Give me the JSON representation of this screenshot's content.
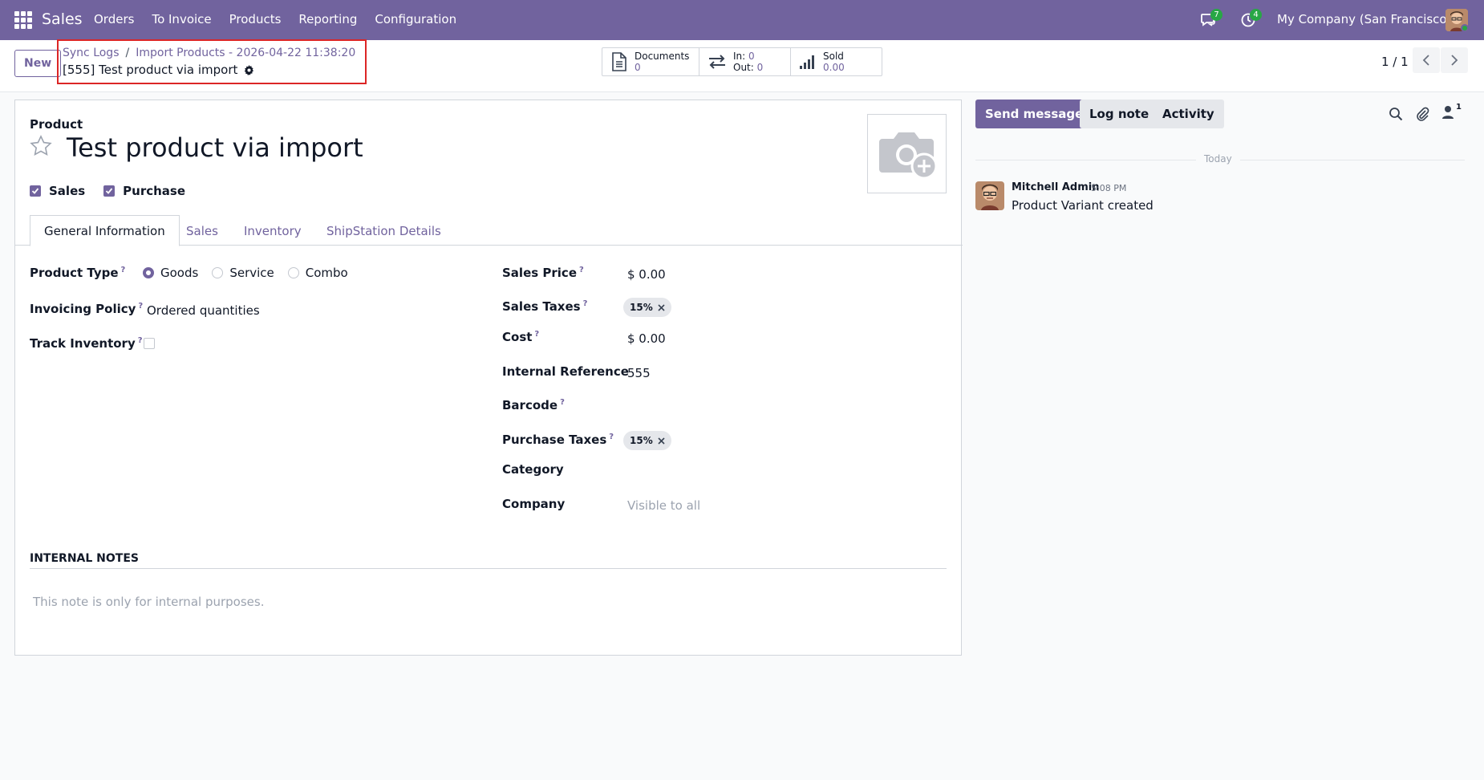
{
  "navbar": {
    "brand": "Sales",
    "menu": [
      "Orders",
      "To Invoice",
      "Products",
      "Reporting",
      "Configuration"
    ],
    "chat_count": "7",
    "activity_count": "4",
    "company": "My Company (San Francisco)"
  },
  "control": {
    "new_label": "New",
    "breadcrumb": [
      "Sync Logs",
      "Import Products - 2026-04-22 11:38:20"
    ],
    "breadcrumb_sep": "/",
    "record_title": "[555] Test product via import",
    "stats": {
      "documents_label": "Documents",
      "documents_value": "0",
      "in_label": "In: ",
      "in_value": "0",
      "out_label": "Out: ",
      "out_value": "0",
      "sold_label": "Sold",
      "sold_value": "0.00"
    },
    "pager": "1 / 1"
  },
  "form": {
    "product_label": "Product",
    "product_name": "Test product via import",
    "sales_check": "Sales",
    "purchase_check": "Purchase",
    "tabs": [
      "General Information",
      "Sales",
      "Inventory",
      "ShipStation Details"
    ],
    "left": {
      "product_type_label": "Product Type",
      "product_type_options": [
        "Goods",
        "Service",
        "Combo"
      ],
      "invoicing_policy_label": "Invoicing Policy",
      "invoicing_policy_value": "Ordered quantities",
      "track_inventory_label": "Track Inventory"
    },
    "right": {
      "sales_price_label": "Sales Price",
      "sales_price_value": "$ 0.00",
      "sales_taxes_label": "Sales Taxes",
      "sales_taxes_value": "15%",
      "cost_label": "Cost",
      "cost_value": "$ 0.00",
      "internal_ref_label": "Internal Reference",
      "internal_ref_value": "555",
      "barcode_label": "Barcode",
      "purchase_taxes_label": "Purchase Taxes",
      "purchase_taxes_value": "15%",
      "category_label": "Category",
      "company_label": "Company",
      "company_placeholder": "Visible to all"
    },
    "help_mark": "?",
    "notes_title": "INTERNAL NOTES",
    "notes_placeholder": "This note is only for internal purposes."
  },
  "chatter": {
    "send_message": "Send message",
    "log_note": "Log note",
    "activity": "Activity",
    "followers_count": "1",
    "today": "Today",
    "author": "Mitchell Admin",
    "time": "5:08 PM",
    "body": "Product Variant created"
  },
  "colors": {
    "brand": "#71639e",
    "badge": "#28a745",
    "highlight": "#dc2626"
  }
}
